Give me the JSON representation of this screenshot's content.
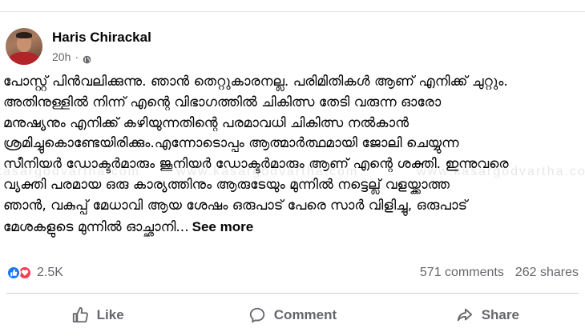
{
  "post": {
    "author": "Haris Chirackal",
    "time": "20h",
    "separator": "·",
    "privacy_icon": "globe-icon",
    "body_lines": [
      "പോസ്റ്റ് പിൻവലിക്കുന്നു. ഞാൻ തെറ്റുകാരനല്ല. പരിമിതികൾ ആണ് എനിക്ക് ചുറ്റും.",
      "അതിനുള്ളിൽ നിന്ന്  എന്റെ വിഭാഗത്തിൽ ചികിത്സ തേടി വരുന്ന ഓരോ",
      "മനുഷ്യനും എനിക്ക് കഴിയുന്നതിന്റെ പരമാവധി ചികിത്സ നൽകാൻ",
      "ശ്രമിച്ചുകൊണ്ടേയിരിക്കും.എന്നോടൊപ്പം ആത്മാർത്ഥമായി ജോലി ചെയ്യുന്ന",
      "സീനിയർ ഡോക്ടർമാരും ജൂനിയർ ഡോക്ടർമാരും ആണ് എന്റെ ശക്തി. ഇന്നുവരെ",
      "വ്യക്തി പരമായ  ഒരു കാര്യത്തിനും ആരുടേയും മുന്നിൽ നട്ടെല്ല് വളയ്ക്കാത്ത",
      "ഞാൻ, വകുപ്പ് മേധാവി ആയ ശേഷം ഒരുപാട് പേരെ സാർ വിളിച്ചു, ഒരുപാട്",
      "മേശകളുടെ മുന്നിൽ ഓച്ഛാനി..."
    ],
    "see_more": "See more"
  },
  "stats": {
    "reaction_icons": [
      "like-reaction-icon",
      "love-reaction-icon"
    ],
    "reactions_count": "2.5K",
    "comments": "571 comments",
    "shares": "262 shares"
  },
  "actions": {
    "like": "Like",
    "comment": "Comment",
    "share": "Share"
  },
  "watermarks": [
    "kasargodvartha.com",
    "www.kasargodvartha.com",
    "www.kasargodvartha.com"
  ],
  "colors": {
    "secondary_text": "#65676b",
    "primary_text": "#050505",
    "like_blue": "#1877f2",
    "love_red": "#f33e58"
  }
}
